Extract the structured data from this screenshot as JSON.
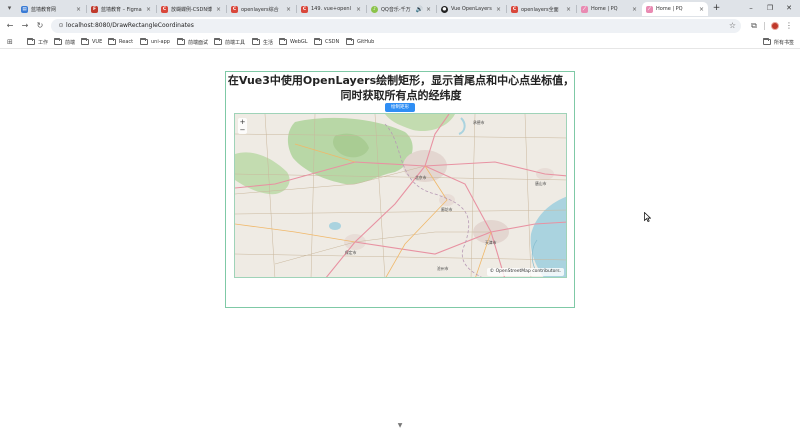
{
  "tabs": [
    {
      "title": "蓝墙教育网",
      "favicon": "doc-icon",
      "color": "#3a7bd5",
      "glyph": "▤"
    },
    {
      "title": "蓝墙教育 – Figma",
      "favicon": "figma-icon",
      "color": "#c0392b",
      "glyph": "F"
    },
    {
      "title": "放蝴蝶例-CSDN博",
      "favicon": "csdn-icon",
      "color": "#d9463a",
      "glyph": "C"
    },
    {
      "title": "openlayers综合",
      "favicon": "csdn-icon",
      "color": "#d9463a",
      "glyph": "C"
    },
    {
      "title": "149. vue+openl",
      "favicon": "csdn-icon",
      "color": "#d9463a",
      "glyph": "C"
    },
    {
      "title": "QQ音乐-千万",
      "favicon": "qqmusic-icon",
      "color": "#8bc34a",
      "glyph": "♪",
      "audio": "🔊"
    },
    {
      "title": "Vue OpenLayers",
      "favicon": "github-icon",
      "color": "#222222",
      "glyph": "●"
    },
    {
      "title": "openlayers全面",
      "favicon": "csdn-icon",
      "color": "#d9463a",
      "glyph": "C"
    },
    {
      "title": "Home | PQ",
      "favicon": "pq-icon",
      "color": "#e98ab2",
      "glyph": "⟋"
    },
    {
      "title": "Home | PQ",
      "favicon": "pq-icon",
      "color": "#e98ab2",
      "glyph": "⟋",
      "active": true
    }
  ],
  "tab_close_glyph": "×",
  "new_tab_glyph": "+",
  "window": {
    "minimize": "–",
    "restore": "❐",
    "close": "✕"
  },
  "toolbar": {
    "back": "←",
    "forward": "→",
    "reload": "↻",
    "url": "localhost:8080/DrawRectangleCoordinates",
    "site_info": "⊙",
    "bookmark_star": "☆",
    "extensions": "⧉",
    "menu": "⋮"
  },
  "bookmarks": {
    "apps_glyph": "⊞",
    "items": [
      "工作",
      "前端",
      "VUE",
      "React",
      "uni-app",
      "前端面试",
      "前端工具",
      "生活",
      "WebGL",
      "CSDN",
      "GitHub"
    ],
    "all_label": "所有书签"
  },
  "page": {
    "title": "在Vue3中使用OpenLayers绘制矩形，显示首尾点和中心点坐标值，同时获取所有点的经纬度",
    "draw_button": "绘制矩形",
    "zoom_in": "+",
    "zoom_out": "−",
    "attribution": "© OpenStreetMap contributors.",
    "map_labels": [
      "北京市",
      "廊坊市",
      "天津市",
      "保定市",
      "唐山市",
      "沧州市",
      "承德市"
    ]
  },
  "colors": {
    "accent": "#2f8ef4",
    "card_border": "#7fc9a6",
    "water": "#aad3df",
    "forest": "#add19e"
  },
  "scroll_indicator": "▼"
}
